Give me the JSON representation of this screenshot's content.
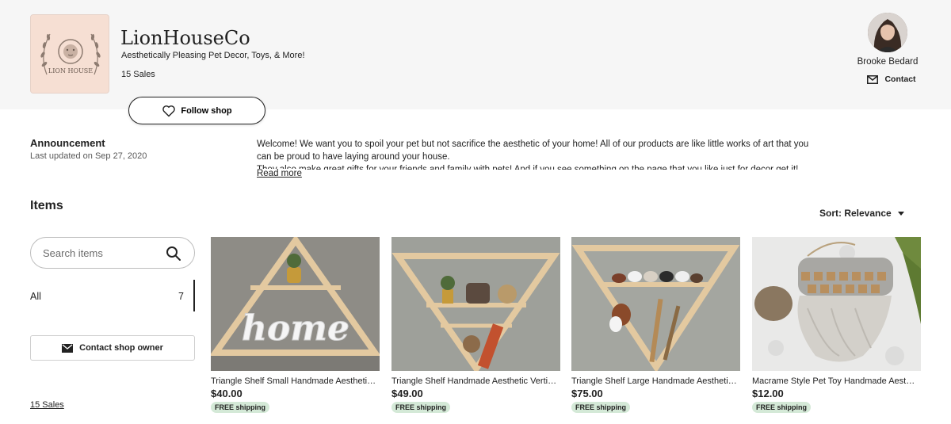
{
  "shop": {
    "name": "LionHouseCo",
    "tagline": "Aesthetically Pleasing Pet Decor, Toys, & More!",
    "sales": "15 Sales",
    "logo_text": "LION HOUSE",
    "follow_label": "Follow shop"
  },
  "owner": {
    "name": "Brooke Bedard",
    "contact_label": "Contact"
  },
  "announcement": {
    "title": "Announcement",
    "updated": "Last updated on Sep 27, 2020",
    "text_line1": "Welcome! We want you to spoil your pet but not sacrifice the aesthetic of your home! All of our products are like little works of art that you",
    "text_line2": "can be proud to have laying around your house.",
    "text_line3": "They also make great gifts for your friends and family with pets! And if you see something on the page that you like just for decor get it!",
    "read_more": "Read more"
  },
  "items": {
    "title": "Items",
    "sort_label": "Sort: Relevance",
    "search_placeholder": "Search items",
    "categories": [
      {
        "label": "All",
        "count": "7"
      }
    ],
    "contact_owner_label": "Contact shop owner",
    "sales_link": "15 Sales"
  },
  "listings": [
    {
      "title": "Triangle Shelf Small Handmade Aesthetic Boho Decor",
      "price": "$40.00",
      "shipping": "FREE shipping",
      "image_word": "home"
    },
    {
      "title": "Triangle Shelf Handmade Aesthetic Vertical Decor",
      "price": "$49.00",
      "shipping": "FREE shipping"
    },
    {
      "title": "Triangle Shelf Large Handmade Aesthetic Pet Decor",
      "price": "$75.00",
      "shipping": "FREE shipping"
    },
    {
      "title": "Macrame Style Pet Toy Handmade Aesthetic Cat Toy",
      "price": "$12.00",
      "shipping": "FREE shipping"
    }
  ],
  "colors": {
    "header_bg": "#f6f6f6",
    "logo_bg": "#f6dfd3",
    "shipping_badge": "#d4e9d7",
    "text": "#222222"
  },
  "icons": [
    "heart-icon",
    "mail-icon",
    "search-icon",
    "chevron-down-icon"
  ]
}
